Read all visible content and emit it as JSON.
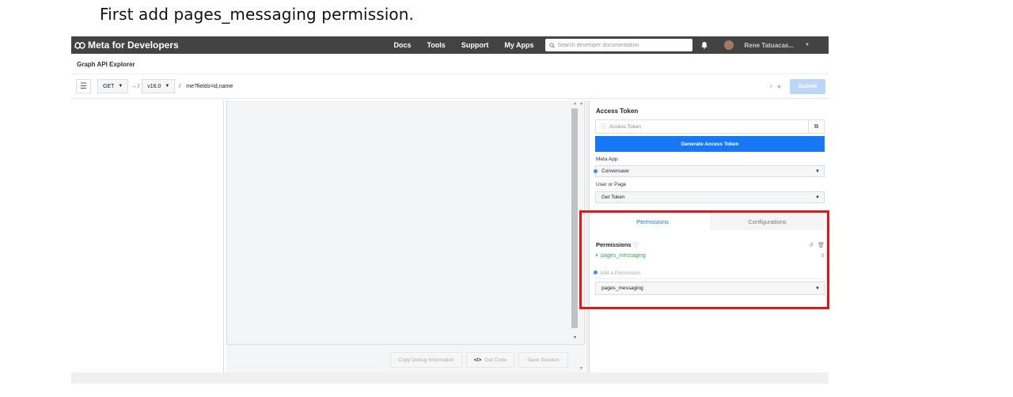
{
  "caption": "First add pages_messaging permission.",
  "topbar": {
    "brand": "Meta for Developers",
    "nav": [
      "Docs",
      "Tools",
      "Support",
      "My Apps"
    ],
    "search_placeholder": "Search developer documentation",
    "user_name": "Rene Tatuacas..."
  },
  "page_title": "Graph API Explorer",
  "query": {
    "method": "GET",
    "arrow": "→ /",
    "version": "v16.0",
    "slash": "/",
    "path": "me?fields=id,name",
    "submit_label": "Submit"
  },
  "bottom_buttons": {
    "copy_debug": "Copy Debug Information",
    "get_code": "Get Code",
    "save_session": "Save Session"
  },
  "right": {
    "access_token_title": "Access Token",
    "access_token_placeholder": "Access Token",
    "generate_label": "Generate Access Token",
    "meta_app_label": "Meta App",
    "meta_app_value": "Conversave",
    "user_or_page_label": "User or Page",
    "user_or_page_value": "Get Token",
    "tabs": [
      "Permissions",
      "Configurations"
    ],
    "permissions_title": "Permissions",
    "permission_item": "pages_messaging",
    "add_permission_placeholder": "Add a Permission",
    "permission_select_value": "pages_messaging"
  },
  "colors": {
    "topbar": "#434343",
    "accent": "#1877f2",
    "highlight": "#e31515",
    "permission_green": "#2db334"
  }
}
